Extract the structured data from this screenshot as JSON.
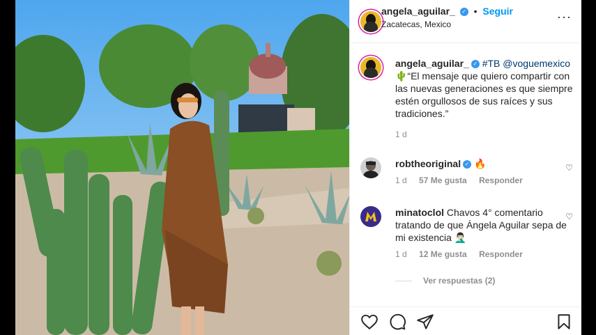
{
  "header": {
    "username": "angela_aguilar_",
    "verified_icon": "verified-badge-icon",
    "dot": "•",
    "follow_label": "Seguir",
    "location": "Zacatecas, Mexico",
    "more_label": "···"
  },
  "caption": {
    "username": "angela_aguilar_",
    "tags": "#TB @voguemexico",
    "text": "🌵“El mensaje que quiero compartir con las nuevas generaciones es que siempre estén orgullosos de sus raíces y sus tradiciones.”",
    "time": "1 d"
  },
  "comments": [
    {
      "username": "robtheoriginal",
      "text": "🔥",
      "time": "1 d",
      "likes": "57 Me gusta",
      "reply_label": "Responder"
    },
    {
      "username": "minatoclol",
      "text": "Chavos 4° comentario tratando de que Ángela Aguilar sepa de mi existencia 🤦🏻‍♂️",
      "time": "1 d",
      "likes": "12 Me gusta",
      "reply_label": "Responder"
    }
  ],
  "view_replies": "Ver respuestas (2)",
  "colors": {
    "accent": "#0095f6",
    "verified": "#3897f0",
    "text": "#262626",
    "muted": "#8e8e8e"
  }
}
